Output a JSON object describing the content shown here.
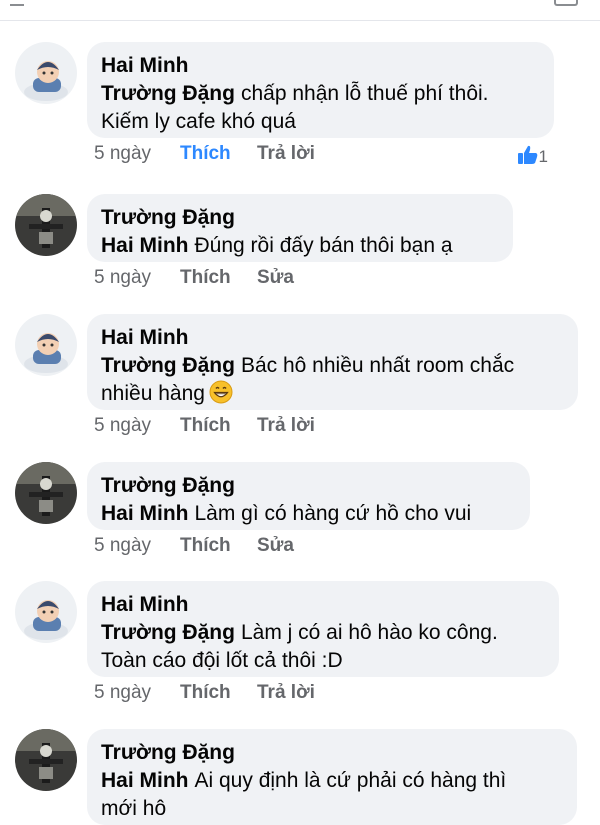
{
  "accent_color": "#2d88ff",
  "comments": [
    {
      "author": "Hai Minh",
      "mention": "Trường Đặng",
      "line1": "chấp nhận lỗ thuế phí thôi.",
      "line2": "Kiếm ly cafe khó quá",
      "time": "5 ngày",
      "like": "Thích",
      "action": "Trả lời",
      "reaction_count": "1",
      "reaction_icon": "thumbs-up-icon",
      "avatar": "baby-avatar"
    },
    {
      "author": "Trường Đặng",
      "mention": "Hai Minh",
      "line1": "Đúng rồi đấy bán thôi bạn ạ",
      "time": "5 ngày",
      "like": "Thích",
      "action": "Sửa",
      "avatar": "motorbike-avatar"
    },
    {
      "author": "Hai Minh",
      "mention": "Trường Đặng",
      "line1": "Bác hô nhiều nhất room chắc",
      "line2": "nhiều hàng",
      "emoji": "grinning-face-emoji",
      "time": "5 ngày",
      "like": "Thích",
      "action": "Trả lời",
      "avatar": "baby-avatar"
    },
    {
      "author": "Trường Đặng",
      "mention": "Hai Minh",
      "line1": "Làm gì có hàng cứ hồ cho vui",
      "time": "5 ngày",
      "like": "Thích",
      "action": "Sửa",
      "avatar": "motorbike-avatar"
    },
    {
      "author": "Hai Minh",
      "mention": "Trường Đặng",
      "line1": "Làm j có ai hô hào ko công.",
      "line2": "Toàn cáo đội lốt cả thôi :D",
      "time": "5 ngày",
      "like": "Thích",
      "action": "Trả lời",
      "avatar": "baby-avatar"
    },
    {
      "author": "Trường Đặng",
      "mention": "Hai Minh",
      "line1": "Ai quy định là cứ phải có hàng thì",
      "line2": "mới hô",
      "avatar": "motorbike-avatar"
    }
  ]
}
